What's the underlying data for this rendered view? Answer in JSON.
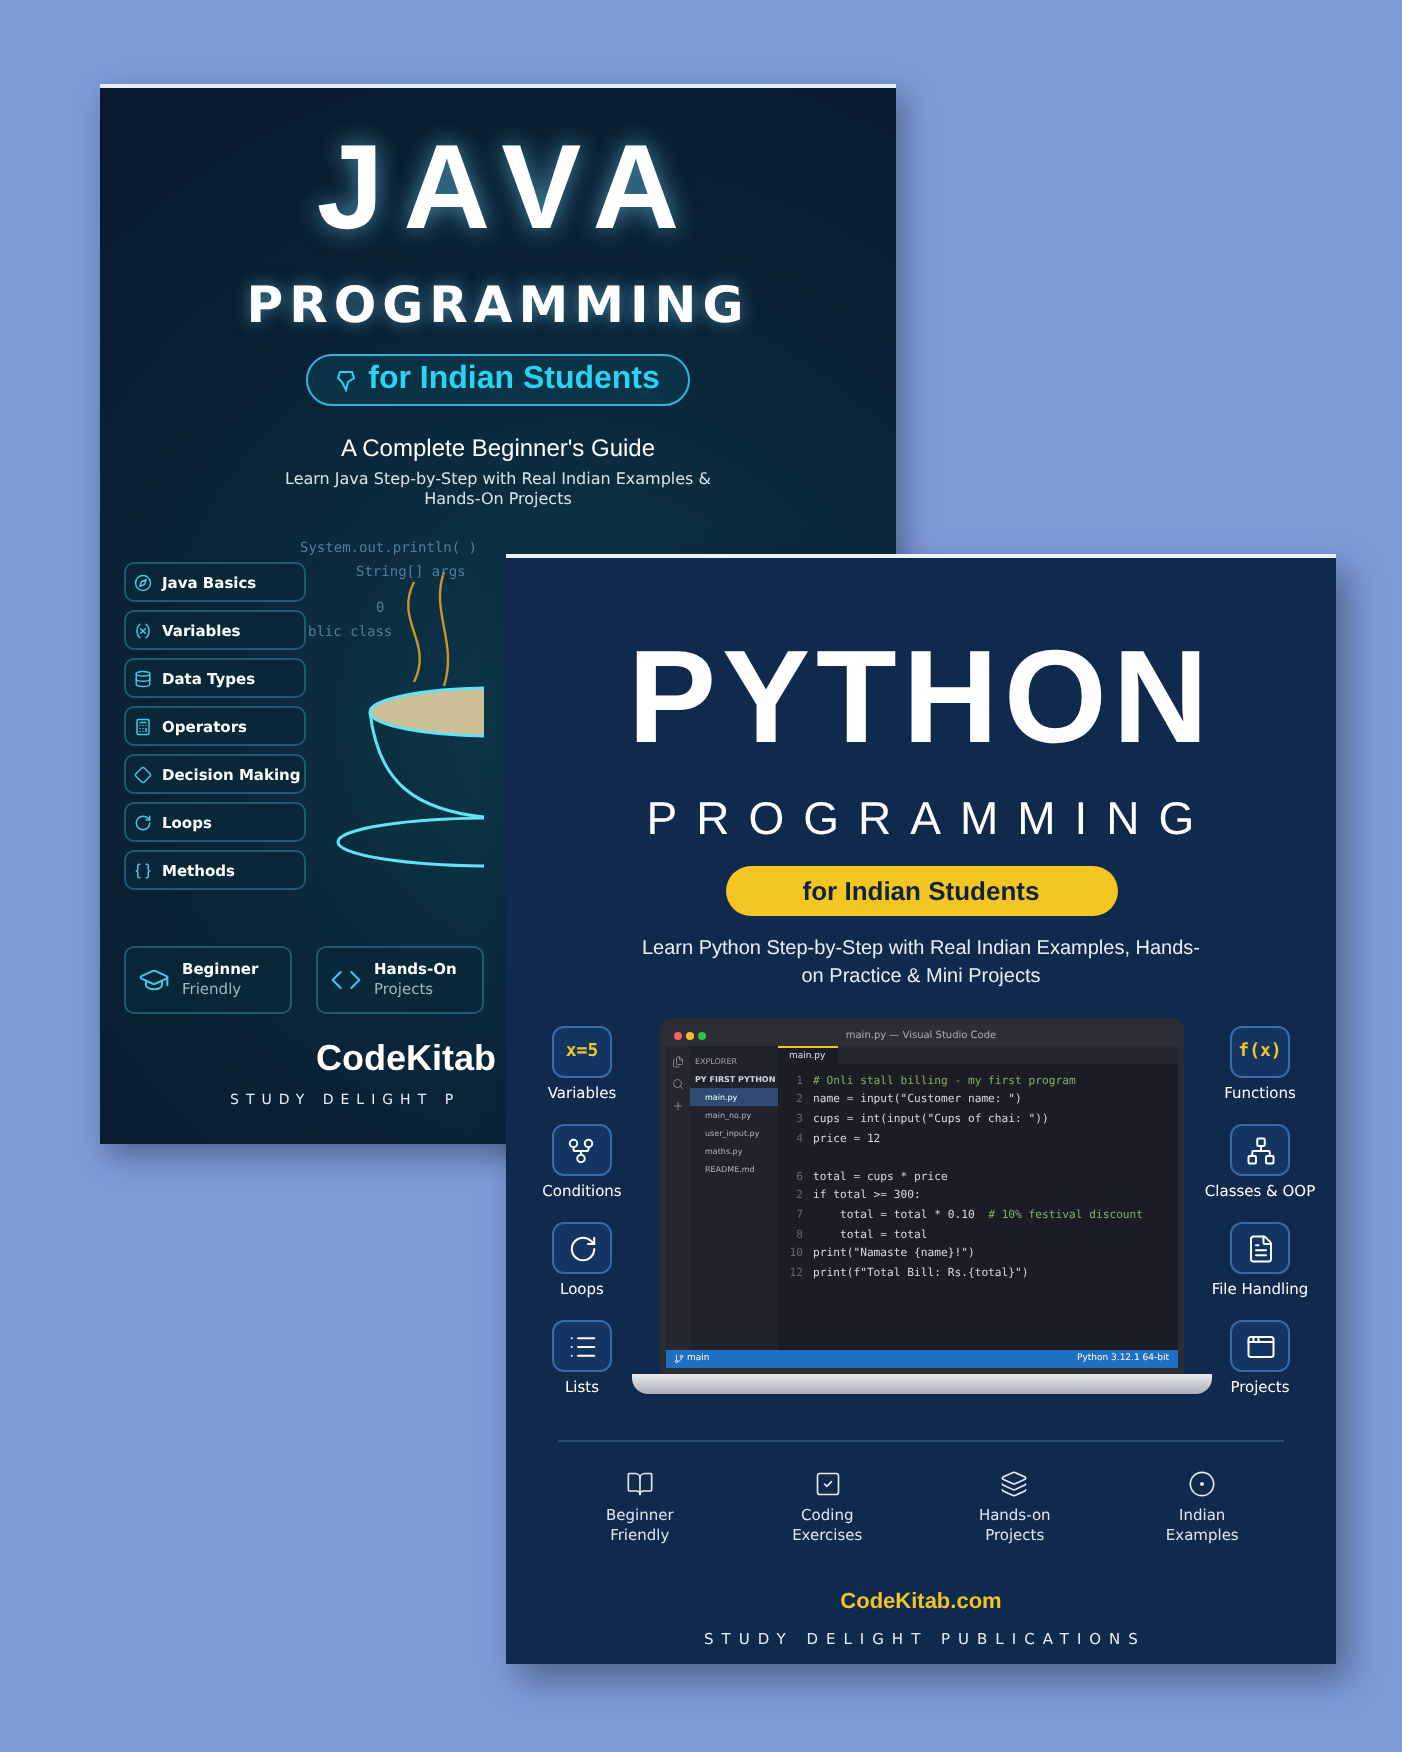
{
  "java_book": {
    "title": "JAVA",
    "subtitle": "PROGRAMMING",
    "audience": "for Indian Students",
    "tagline": "A Complete Beginner's Guide",
    "description": "Learn Java Step-by-Step with Real Indian Examples & Hands-On Projects",
    "code_snippets": [
      "System.out.println( )",
      "String[] args",
      "0",
      "blic class"
    ],
    "topics": [
      "Java Basics",
      "Variables",
      "Data Types",
      "Operators",
      "Decision Making",
      "Loops",
      "Methods"
    ],
    "badges": [
      {
        "title": "Beginner",
        "caption": "Friendly"
      },
      {
        "title": "Hands-On",
        "caption": "Projects"
      }
    ],
    "brand": "CodeKitab",
    "publisher": "STUDY DELIGHT P"
  },
  "python_book": {
    "title": "PYTHON",
    "subtitle": "PROGRAMMING",
    "audience": "for Indian Students",
    "description": "Learn Python Step-by-Step with Real Indian Examples, Hands-on Practice & Mini Projects",
    "left_topics": [
      {
        "label": "Variables",
        "glyph": "x=5"
      },
      {
        "label": "Conditions"
      },
      {
        "label": "Loops"
      },
      {
        "label": "Lists"
      }
    ],
    "right_topics": [
      {
        "label": "Functions",
        "glyph": "f(x)"
      },
      {
        "label": "Classes & OOP"
      },
      {
        "label": "File Handling"
      },
      {
        "label": "Projects"
      }
    ],
    "editor": {
      "window_title": "main.py — Visual Studio Code",
      "explorer_title": "EXPLORER",
      "folder": "PY FIRST PYTHON",
      "tab": "main.py",
      "files": [
        {
          "name": "main.py",
          "selected": true
        },
        {
          "name": "main_no.py",
          "selected": false
        },
        {
          "name": "user_input.py",
          "selected": false
        },
        {
          "name": "maths.py",
          "selected": false
        },
        {
          "name": "README.md",
          "selected": false
        }
      ],
      "lines": [
        {
          "number": "1",
          "comment": "# Onli stall billing - my first program"
        },
        {
          "number": "2",
          "code": "name = input(\"Customer name: \")"
        },
        {
          "number": "3",
          "code": "cups = int(input(\"Cups of chai: \"))"
        },
        {
          "number": "4",
          "code": "price = 12"
        },
        {
          "number": "6",
          "code": "total = cups * price",
          "gap_before": true
        },
        {
          "number": "2",
          "code": "if total >= 300:"
        },
        {
          "number": "7",
          "code": "    total = total * 0.10",
          "comment": "# 10% festival discount"
        },
        {
          "number": "8",
          "code": "    total = total"
        },
        {
          "number": "10",
          "code": "print(\"Namaste {name}!\")"
        },
        {
          "number": "12",
          "code": "print(f\"Total Bill: Rs.{total}\")"
        }
      ],
      "branch": "main",
      "status": "Python 3.12.1 64-bit"
    },
    "features": [
      "Beginner Friendly",
      "Coding Exercises",
      "Hands-on Projects",
      "Indian Examples"
    ],
    "website": "CodeKitab.com",
    "publisher": "STUDY DELIGHT PUBLICATIONS"
  }
}
